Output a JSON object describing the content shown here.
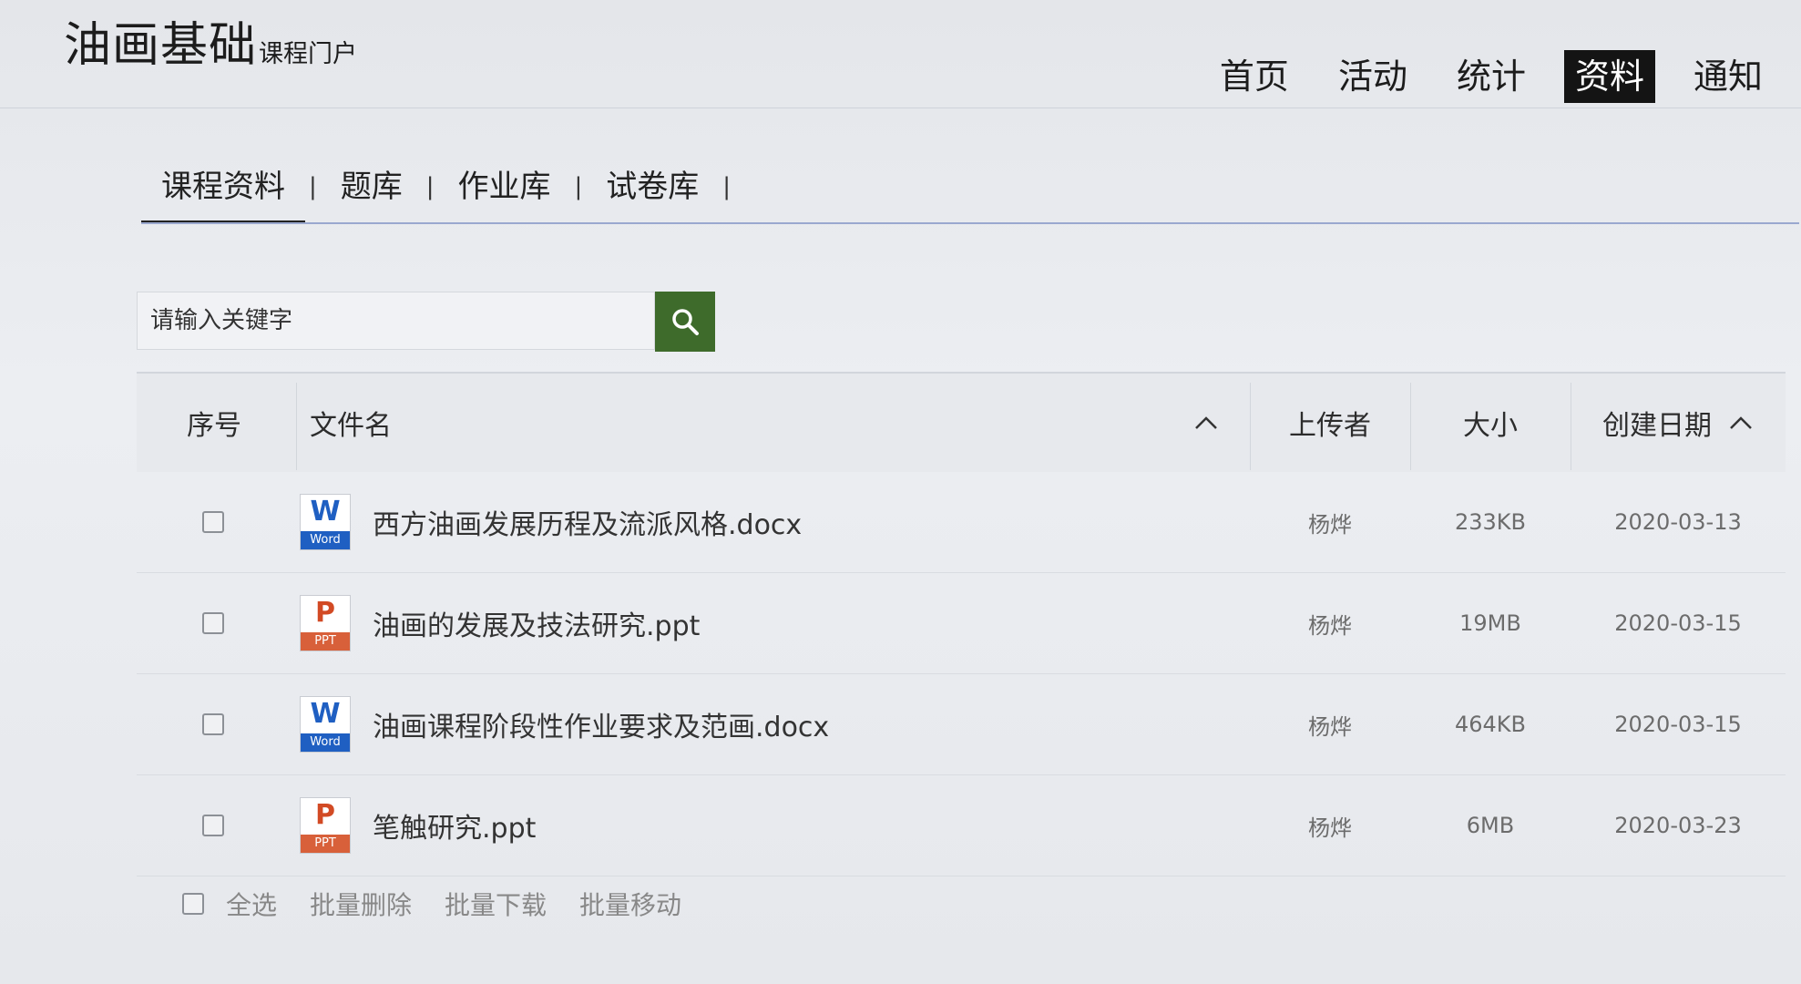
{
  "brand": {
    "title": "油画基础",
    "subtitle": "课程门户"
  },
  "nav": [
    {
      "label": "首页"
    },
    {
      "label": "活动"
    },
    {
      "label": "统计"
    },
    {
      "label": "资料",
      "active": true
    },
    {
      "label": "通知"
    }
  ],
  "subtabs": [
    {
      "label": "课程资料",
      "active": true
    },
    {
      "label": "题库"
    },
    {
      "label": "作业库"
    },
    {
      "label": "试卷库"
    }
  ],
  "subtab_separator": "|",
  "search": {
    "placeholder": "请输入关键字",
    "icon": "search-icon"
  },
  "table": {
    "headers": {
      "index": "序号",
      "filename": "文件名",
      "uploader": "上传者",
      "size": "大小",
      "created": "创建日期"
    },
    "rows": [
      {
        "type": "word",
        "name": "西方油画发展历程及流派风格.docx",
        "uploader": "杨烨",
        "size": "233KB",
        "date": "2020-03-13"
      },
      {
        "type": "ppt",
        "name": "油画的发展及技法研究.ppt",
        "uploader": "杨烨",
        "size": "19MB",
        "date": "2020-03-15"
      },
      {
        "type": "word",
        "name": "油画课程阶段性作业要求及范画.docx",
        "uploader": "杨烨",
        "size": "464KB",
        "date": "2020-03-15"
      },
      {
        "type": "ppt",
        "name": "笔触研究.ppt",
        "uploader": "杨烨",
        "size": "6MB",
        "date": "2020-03-23"
      }
    ]
  },
  "icons": {
    "word": {
      "letter": "W",
      "band": "Word"
    },
    "ppt": {
      "letter": "P",
      "band": "PPT"
    }
  },
  "footer": {
    "select_all": "全选",
    "batch_delete": "批量删除",
    "batch_download": "批量下载",
    "batch_move": "批量移动"
  },
  "colors": {
    "search_button": "#3e6b2b",
    "word_blue": "#1f5fc2",
    "ppt_orange": "#d8603a",
    "nav_active_bg": "#141414"
  }
}
